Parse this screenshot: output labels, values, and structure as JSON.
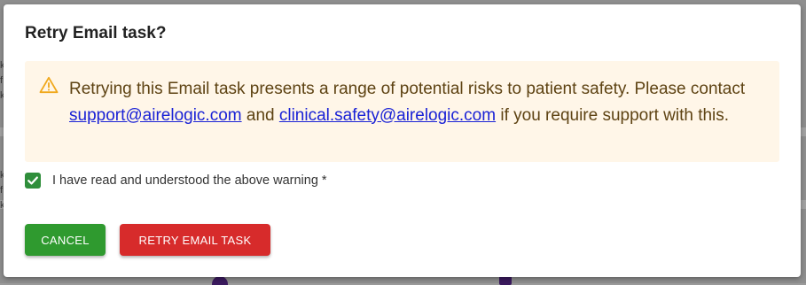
{
  "dialog": {
    "title": "Retry Email task?",
    "warning": {
      "icon": "warning-triangle-icon",
      "text_before": "Retrying this Email task presents a range of potential risks to patient safety. Please contact ",
      "link1": "support@airelogic.com",
      "text_middle": " and ",
      "link2": "clinical.safety@airelogic.com",
      "text_after": " if you require support with this."
    },
    "checkbox": {
      "checked": true,
      "label": "I have read and understood the above warning *"
    },
    "buttons": {
      "cancel": "CANCEL",
      "retry": "RETRY EMAIL TASK"
    }
  },
  "colors": {
    "warning_bg": "#fff6e8",
    "warning_text": "#5e4313",
    "warning_icon": "#f0a81c",
    "cancel_button": "#2f9a2f",
    "retry_button": "#d72b2b",
    "checkbox": "#2f8e3b",
    "link": "#1a22d6"
  }
}
